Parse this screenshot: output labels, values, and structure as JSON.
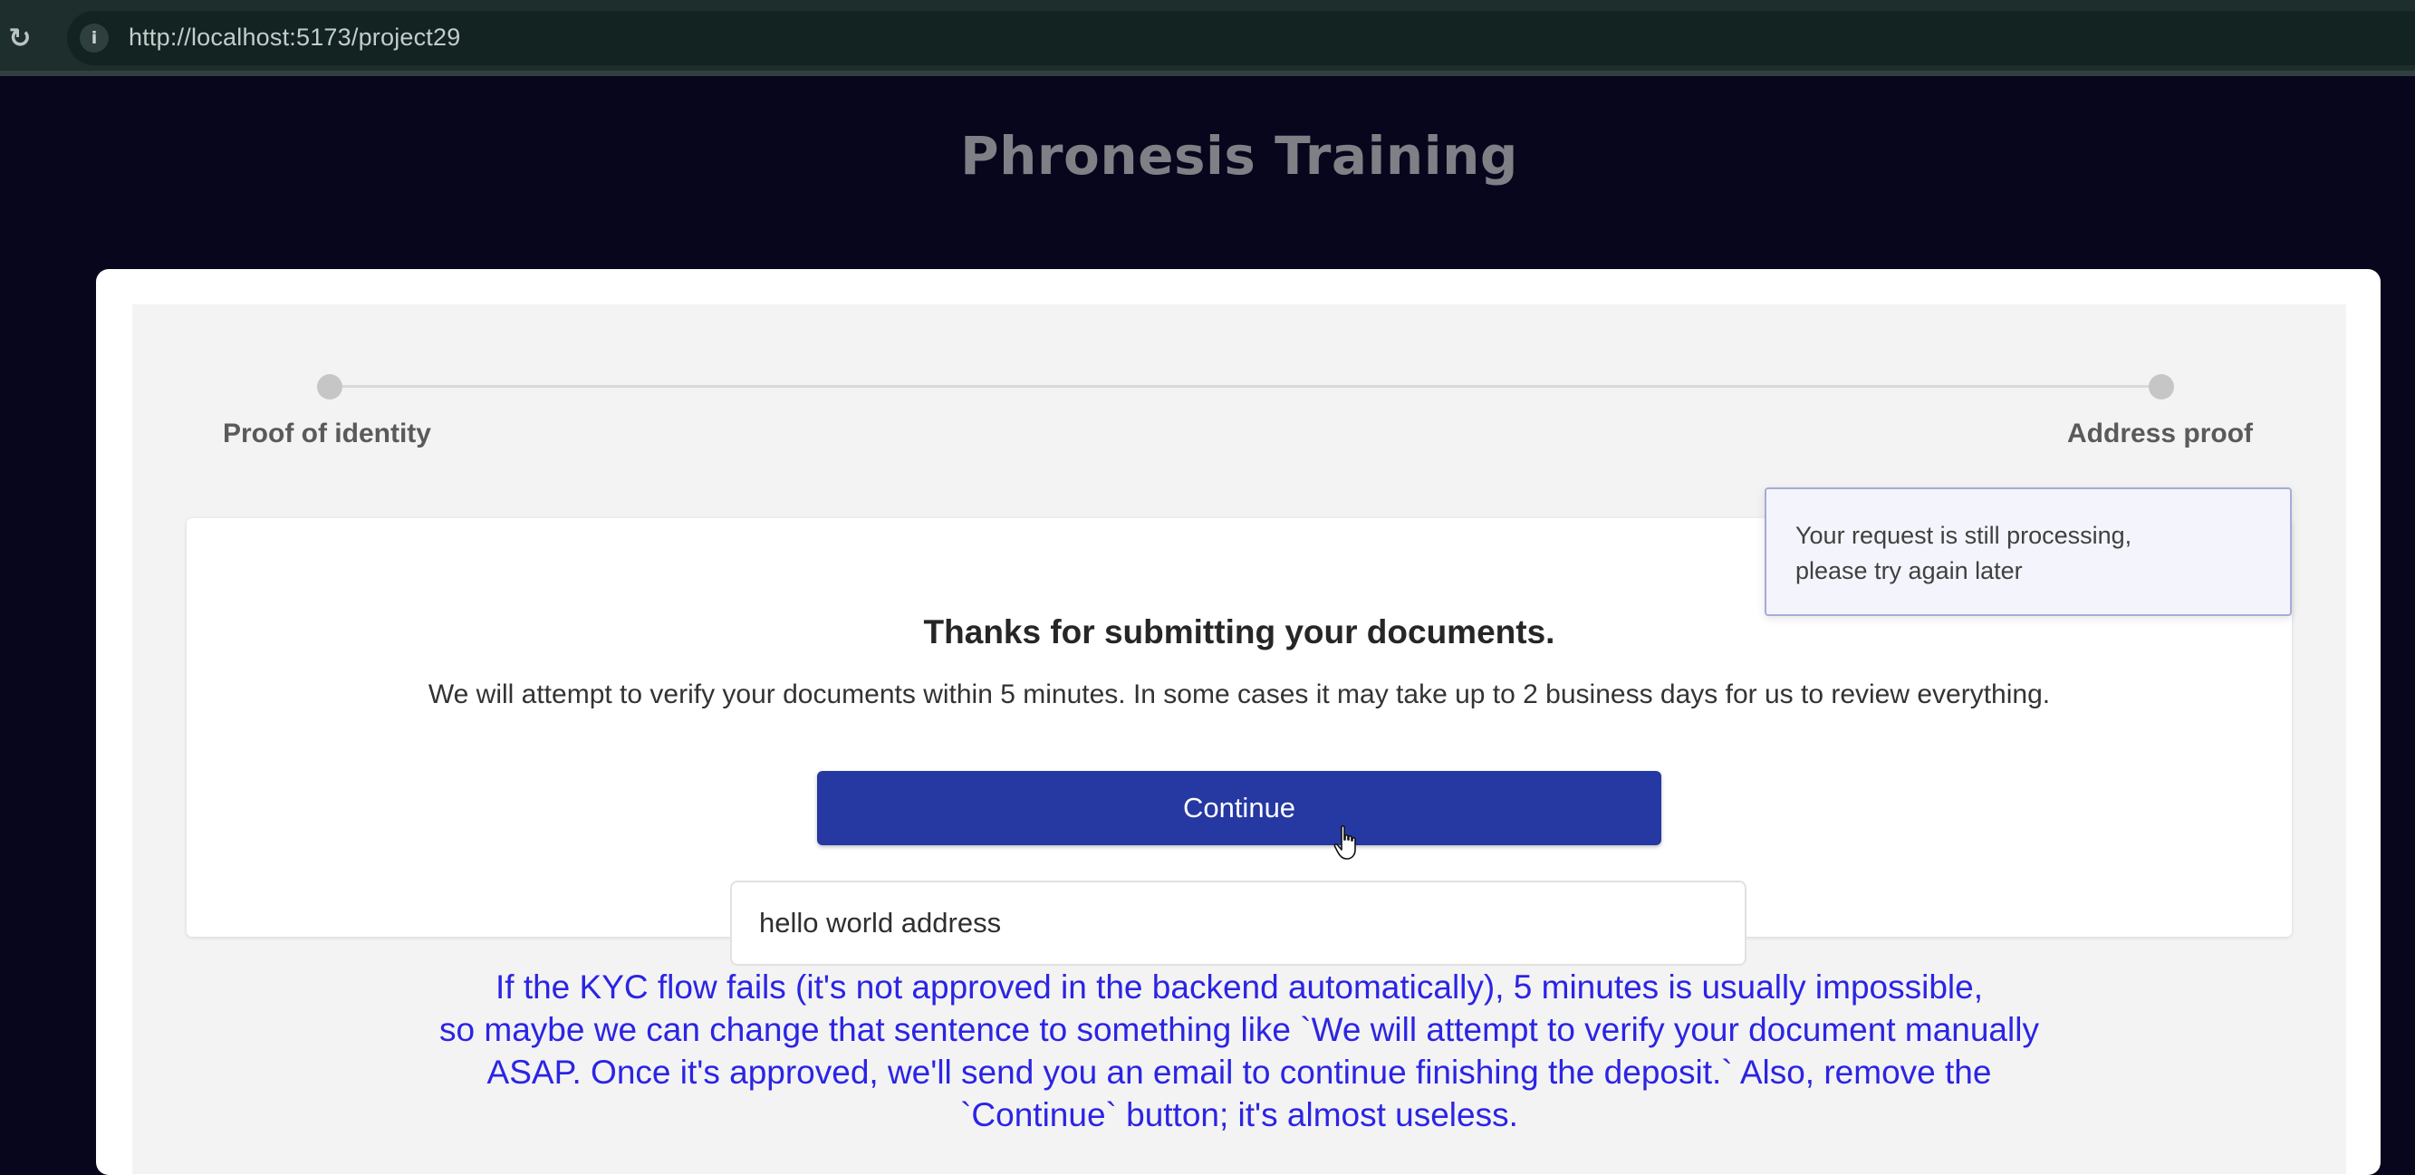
{
  "browser": {
    "reload_icon": "reload-icon",
    "info_icon": "info-icon",
    "url": "http://localhost:5173/project29"
  },
  "app": {
    "title": "Phronesis Training"
  },
  "stepper": {
    "steps": [
      {
        "label": "Proof of identity"
      },
      {
        "label": "Address proof"
      }
    ]
  },
  "content": {
    "heading": "Thanks for submitting your documents.",
    "body": "We will attempt to verify your documents within 5 minutes. In some cases it may take up to 2 business days for us to review everything.",
    "continue_label": "Continue"
  },
  "address_input": {
    "value": "hello world address"
  },
  "toast": {
    "line1": "Your request is still processing,",
    "line2": "please try again later"
  },
  "annotation": {
    "line1": "If the KYC flow fails (it's not approved in the backend automatically), 5 minutes is usually impossible,",
    "line2": "so maybe we can change that sentence to something like `We will attempt to verify your document manually",
    "line3": "ASAP. Once it's approved, we'll send you an email to continue finishing the deposit.` Also, remove the",
    "line4": "`Continue` button; it's almost useless."
  },
  "colors": {
    "page_background": "#07061c",
    "primary_button": "#2638a2",
    "annotation_text": "#2b24e4",
    "toast_border": "#a5acd9"
  }
}
